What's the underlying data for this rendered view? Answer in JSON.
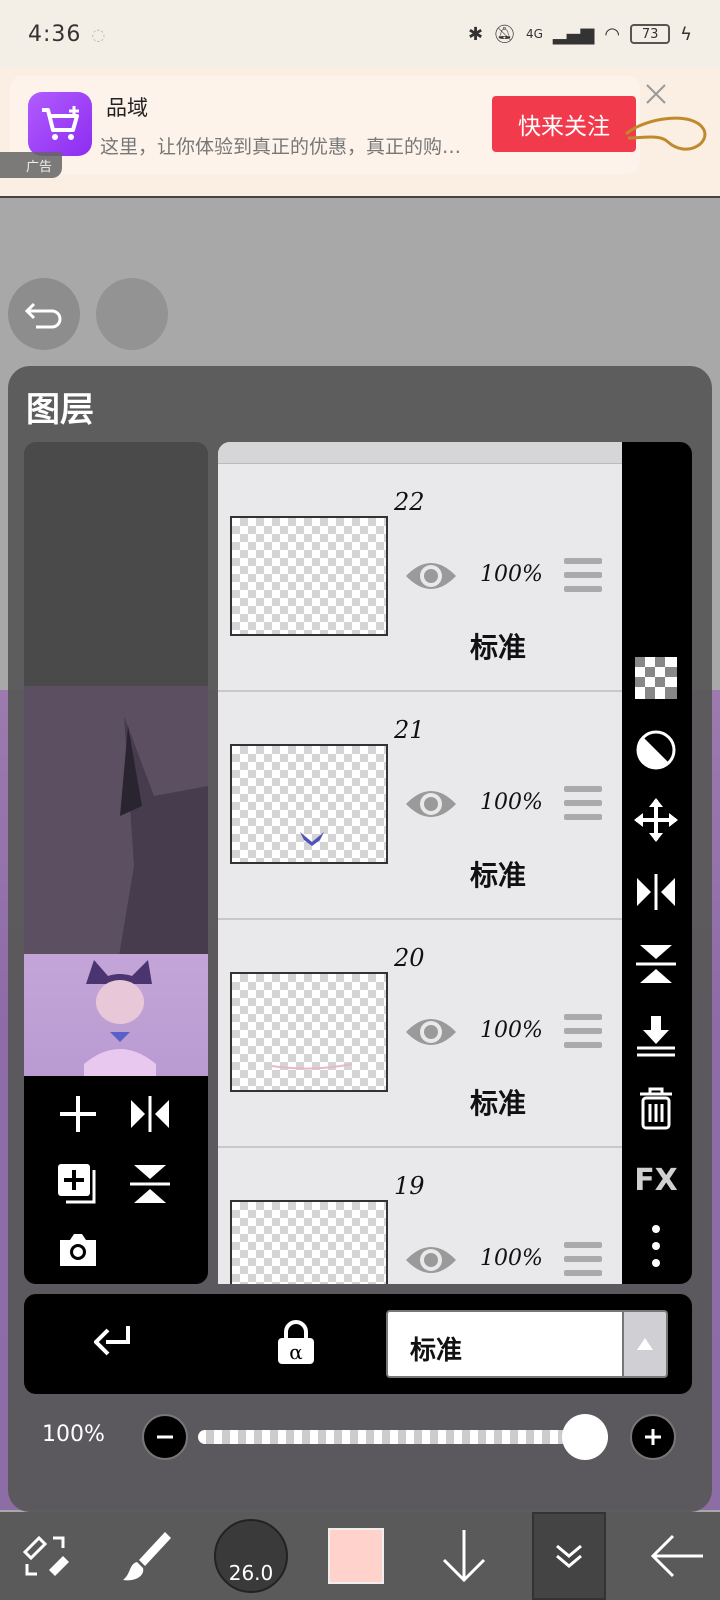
{
  "status_bar": {
    "time": "4:36",
    "network": "4G",
    "battery": "73"
  },
  "ad": {
    "app_name": "品域",
    "description": "这里，让你体验到真正的优惠，真正的购…",
    "cta_label": "快来关注",
    "ad_label": "广告",
    "accent_color": "#f23a4d"
  },
  "layer_panel": {
    "title": "图层",
    "layers": [
      {
        "number": "22",
        "opacity": "100%",
        "blend": "标准"
      },
      {
        "number": "21",
        "opacity": "100%",
        "blend": "标准"
      },
      {
        "number": "20",
        "opacity": "100%",
        "blend": "标准"
      },
      {
        "number": "19",
        "opacity": "100%",
        "blend": ""
      }
    ],
    "side_tools": [
      "checker-icon",
      "half-circle-icon",
      "move-icon",
      "flip-horizontal-icon",
      "flip-vertical-icon",
      "merge-down-icon",
      "trash-icon",
      "FX",
      "more-vertical-icon"
    ],
    "fx_label": "FX",
    "blend_mode": "标准",
    "opacity_label": "100%",
    "opacity_value": 1.0
  },
  "bottom_bar": {
    "brush_size": "26.0",
    "color": "#ffd3cc"
  }
}
